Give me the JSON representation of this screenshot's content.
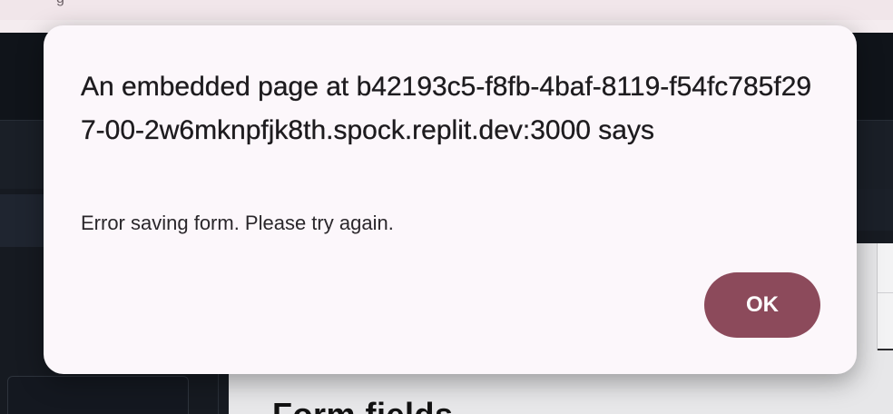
{
  "browser": {
    "tab_fragment": "g"
  },
  "background": {
    "section_heading": "Form fields"
  },
  "dialog": {
    "title": "An embedded page at b42193c5-f8fb-4baf-8119-f54fc785f297-00-2w6mknpfjk8th.spock.replit.dev:3000 says",
    "message": "Error saving form. Please try again.",
    "ok_label": "OK"
  },
  "colors": {
    "dialog_background": "#fcf7fb",
    "button_accent": "#8c4a5b",
    "app_background": "#171b22"
  }
}
